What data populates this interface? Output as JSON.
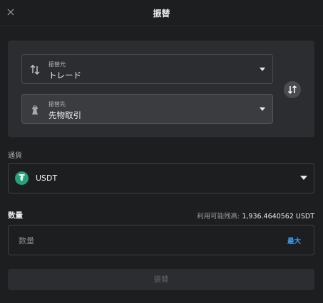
{
  "header": {
    "title": "振替"
  },
  "transfer": {
    "from": {
      "label": "振替元",
      "value": "トレード"
    },
    "to": {
      "label": "振替先",
      "value": "先物取引"
    }
  },
  "currency": {
    "label": "通貨",
    "selected": "USDT",
    "icon_glyph": "₮",
    "icon_color": "#26a17b"
  },
  "amount": {
    "label": "数量",
    "available_label": "利用可能残高:",
    "available_value": "1,936.4640562 USDT",
    "placeholder": "数量",
    "max_label": "最大"
  },
  "submit": {
    "label": "振替"
  },
  "colors": {
    "background": "#1d1e20",
    "panel": "#2c2d30",
    "accent_link": "#3d9ae8"
  }
}
